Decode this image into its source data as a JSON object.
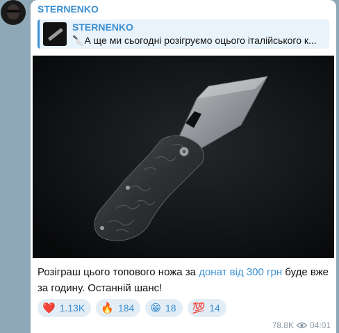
{
  "channel": {
    "name": "STERNENKO"
  },
  "reply": {
    "name": "STERNENKO",
    "icon": "🔪",
    "text": "А ще ми сьогодні розігруємо оцього італійського к..."
  },
  "post": {
    "text_before_link": "Розіграш цього топового ножа за ",
    "link_text": "донат від 300 грн",
    "text_after_link": " буде вже за годину. Останній шанс!"
  },
  "reactions": [
    {
      "emoji": "❤️",
      "count": "1.13K"
    },
    {
      "emoji": "🔥",
      "count": "184"
    },
    {
      "emoji": "😁",
      "count": "18"
    },
    {
      "emoji": "💯",
      "count": "14"
    }
  ],
  "meta": {
    "views": "78.8K",
    "time": "04:01"
  },
  "colors": {
    "accent": "#3a8fd1",
    "reply_bg": "#e9f3fb",
    "reaction_bg": "#e3edf6",
    "chat_bg": "#8fa8b8"
  }
}
